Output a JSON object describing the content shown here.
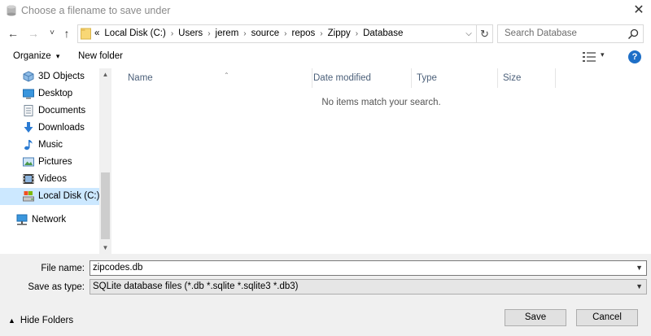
{
  "window": {
    "title": "Choose a filename to save under",
    "close_glyph": "✕",
    "icon": "database-icon"
  },
  "navigation": {
    "back_glyph": "←",
    "forward_glyph": "→",
    "recent_glyph": "˅",
    "up_glyph": "↑"
  },
  "address_bar": {
    "overflow": "«",
    "crumbs": [
      "Local Disk (C:)",
      "Users",
      "jerem",
      "source",
      "repos",
      "Zippy",
      "Database"
    ],
    "separator": "›",
    "dropdown_glyph": "⌵",
    "refresh_glyph": "↻"
  },
  "search": {
    "placeholder": "Search Database"
  },
  "toolbar": {
    "organize": "Organize",
    "organize_arrow": "▾",
    "new_folder": "New folder",
    "views_arrow": "▾",
    "help": "?"
  },
  "nav_pane": {
    "items": [
      {
        "label": "3D Objects",
        "icon": "3d-objects-icon"
      },
      {
        "label": "Desktop",
        "icon": "desktop-icon"
      },
      {
        "label": "Documents",
        "icon": "documents-icon"
      },
      {
        "label": "Downloads",
        "icon": "downloads-icon"
      },
      {
        "label": "Music",
        "icon": "music-icon"
      },
      {
        "label": "Pictures",
        "icon": "pictures-icon"
      },
      {
        "label": "Videos",
        "icon": "videos-icon"
      },
      {
        "label": "Local Disk (C:)",
        "icon": "local-disk-icon",
        "selected": true
      },
      {
        "label": "Network",
        "icon": "network-icon"
      }
    ]
  },
  "file_list": {
    "columns": [
      "Name",
      "Date modified",
      "Type",
      "Size"
    ],
    "empty_message": "No items match your search."
  },
  "save_form": {
    "file_name_label": "File name:",
    "file_name_value": "zipcodes.db",
    "save_as_type_label": "Save as type:",
    "save_as_type_value": "SQLite database files (*.db *.sqlite *.sqlite3 *.db3)",
    "hide_folders": "Hide Folders",
    "save_button": "Save",
    "cancel_button": "Cancel"
  },
  "colors": {
    "selection": "#cce8ff",
    "help_blue": "#1e6fc7",
    "header_text": "#4c607a"
  }
}
